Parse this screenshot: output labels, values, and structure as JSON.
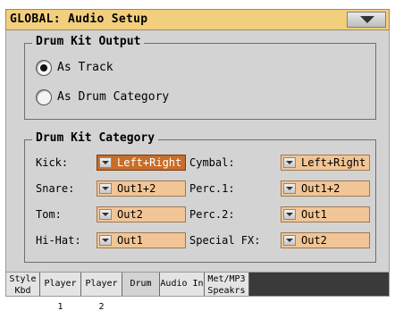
{
  "window": {
    "title": "GLOBAL: Audio Setup",
    "menu_icon": "chevron-down-icon"
  },
  "drum_kit_output": {
    "title": "Drum Kit Output",
    "options": [
      {
        "label": "As Track",
        "selected": true
      },
      {
        "label": "As Drum Category",
        "selected": false
      }
    ]
  },
  "drum_kit_category": {
    "title": "Drum Kit Category",
    "left": [
      {
        "label": "Kick:",
        "value": "Left+Right",
        "active": true
      },
      {
        "label": "Snare:",
        "value": "Out1+2",
        "active": false
      },
      {
        "label": "Tom:",
        "value": "Out2",
        "active": false
      },
      {
        "label": "Hi-Hat:",
        "value": "Out1",
        "active": false
      }
    ],
    "right": [
      {
        "label": "Cymbal:",
        "value": "Left+Right",
        "active": false
      },
      {
        "label": "Perc.1:",
        "value": "Out1+2",
        "active": false
      },
      {
        "label": "Perc.2:",
        "value": "Out1",
        "active": false
      },
      {
        "label": "Special FX:",
        "value": "Out2",
        "active": false
      }
    ]
  },
  "tabs": {
    "style_kbd": {
      "line1": "Style",
      "line2": "Kbd"
    },
    "player1": "Player 1",
    "player2": "Player 2",
    "drum": "Drum",
    "audio_in": "Audio In",
    "met_mp3": {
      "line1": "Met/MP3",
      "line2": "Speakrs"
    },
    "active": "drum"
  },
  "colors": {
    "title_bar": "#f2cf7d",
    "panel": "#d3d3d3",
    "dropdown": "#f1c596",
    "dropdown_active": "#c86d2a"
  }
}
